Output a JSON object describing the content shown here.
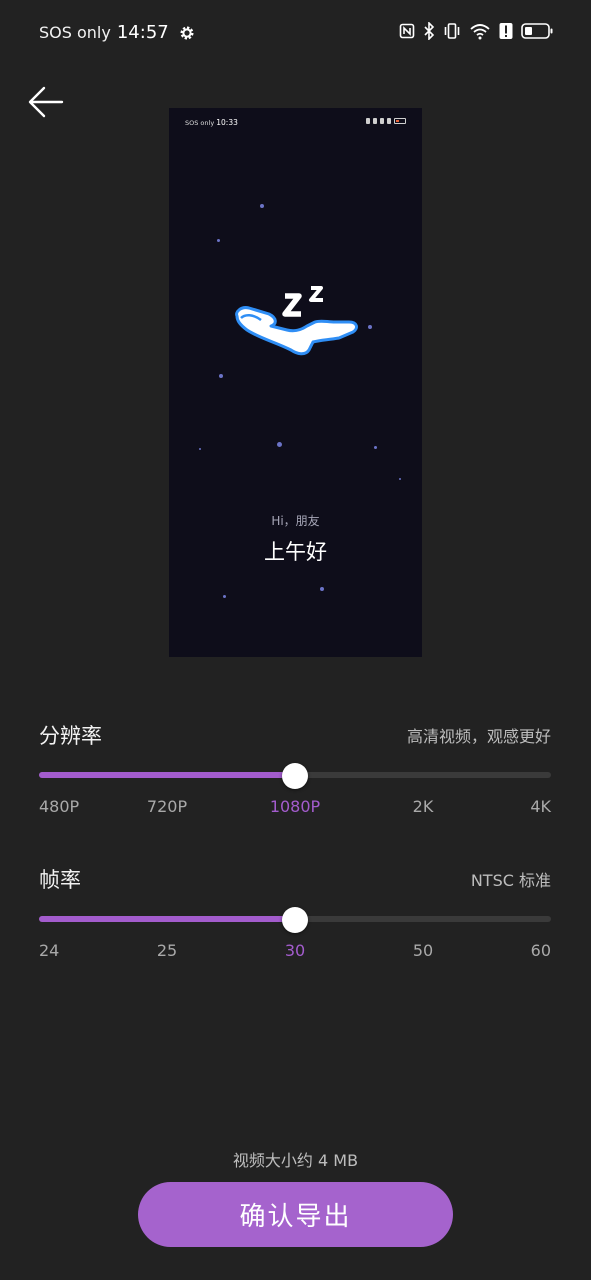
{
  "status_bar": {
    "carrier": "SOS only",
    "time": "14:57",
    "icons": [
      "gear-icon",
      "nfc-icon",
      "bluetooth-icon",
      "vibrate-icon",
      "wifi-icon",
      "alert-icon",
      "battery-icon"
    ]
  },
  "preview": {
    "status_carrier": "SOS only",
    "status_time": "10:33",
    "greeting_small": "Hi，朋友",
    "greeting_large": "上午好"
  },
  "resolution": {
    "title": "分辨率",
    "hint": "高清视频，观感更好",
    "options": [
      "480P",
      "720P",
      "1080P",
      "2K",
      "4K"
    ],
    "selected_index": 2,
    "level": 0.5
  },
  "framerate": {
    "title": "帧率",
    "hint": "NTSC 标准",
    "options": [
      "24",
      "25",
      "30",
      "50",
      "60"
    ],
    "selected_index": 2,
    "level": 0.5
  },
  "size_text": "视频大小约 4 MB",
  "export_label": "确认导出",
  "colors": {
    "background": "#222222",
    "accent": "#a35ccd",
    "button": "#a563cd",
    "preview_bg": "#0e0d1a"
  }
}
